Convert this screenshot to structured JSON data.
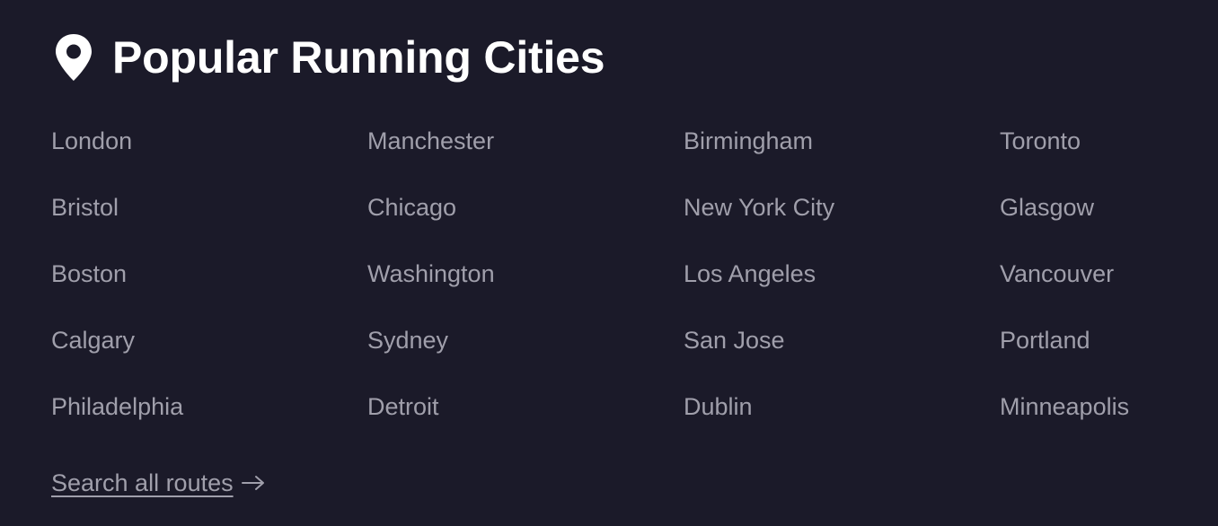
{
  "section": {
    "title": "Popular Running Cities",
    "icon": "map-pin-icon"
  },
  "cities": [
    "London",
    "Manchester",
    "Birmingham",
    "Toronto",
    "Bristol",
    "Chicago",
    "New York City",
    "Glasgow",
    "Boston",
    "Washington",
    "Los Angeles",
    "Vancouver",
    "Calgary",
    "Sydney",
    "San Jose",
    "Portland",
    "Philadelphia",
    "Detroit",
    "Dublin",
    "Minneapolis"
  ],
  "search_link": {
    "label": "Search all routes",
    "icon": "arrow-right-icon"
  },
  "colors": {
    "background": "#1b1a29",
    "title": "#ffffff",
    "link": "#a09fab"
  }
}
